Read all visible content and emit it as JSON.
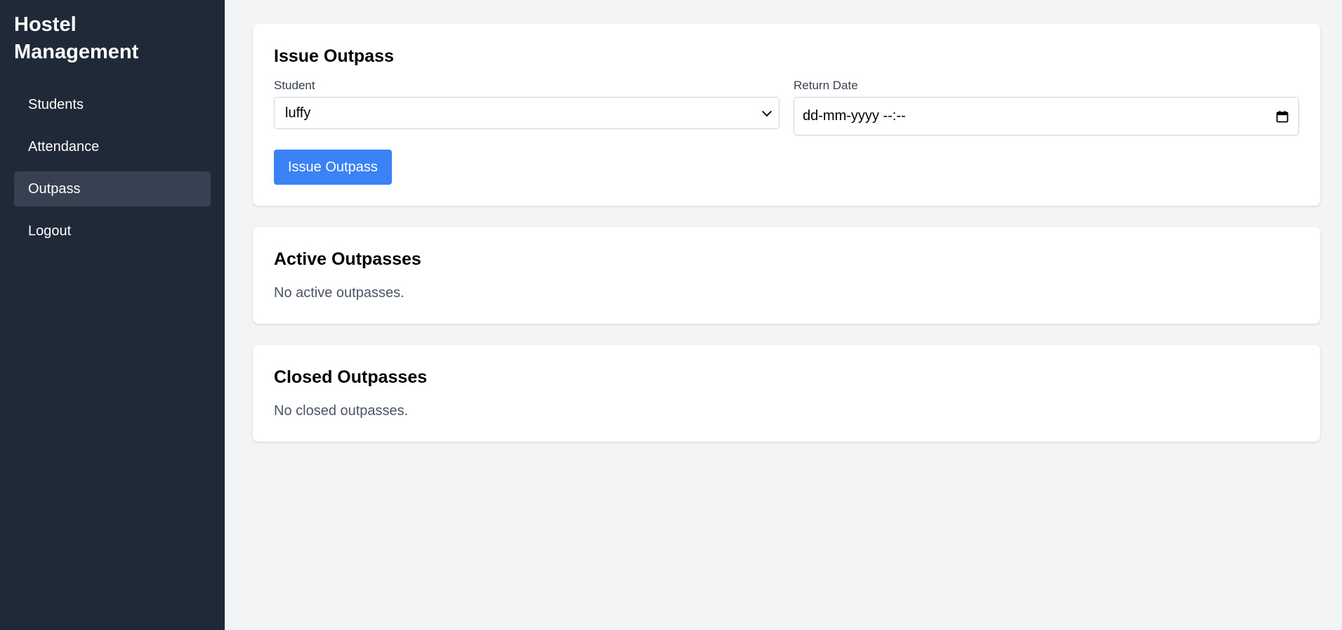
{
  "sidebar": {
    "title": "Hostel\nManagement",
    "items": [
      {
        "label": "Students"
      },
      {
        "label": "Attendance"
      },
      {
        "label": "Outpass"
      },
      {
        "label": "Logout"
      }
    ],
    "active_index": 2
  },
  "issue_card": {
    "title": "Issue Outpass",
    "student_label": "Student",
    "student_value": "luffy",
    "return_label": "Return Date",
    "return_value": "dd-mm-yyyy --:--",
    "submit_label": "Issue Outpass"
  },
  "active_card": {
    "title": "Active Outpasses",
    "empty": "No active outpasses."
  },
  "closed_card": {
    "title": "Closed Outpasses",
    "empty": "No closed outpasses."
  },
  "colors": {
    "sidebar_bg": "#1f2937",
    "active_nav_bg": "#374151",
    "primary": "#3b82f6",
    "page_bg": "#f3f4f6"
  },
  "icons": {
    "date_picker": "calendar-icon",
    "select": "chevron-down-icon"
  }
}
